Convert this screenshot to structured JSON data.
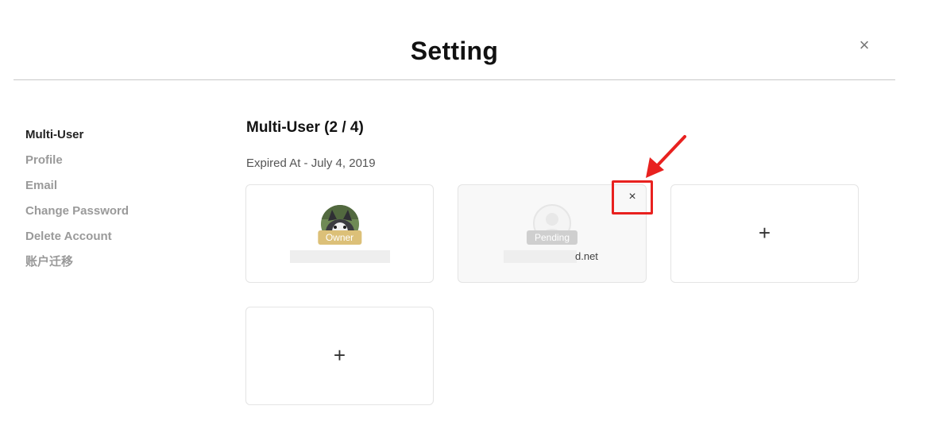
{
  "header": {
    "title": "Setting",
    "close_icon": "×"
  },
  "sidebar": {
    "items": [
      {
        "label": "Multi-User",
        "active": true
      },
      {
        "label": "Profile"
      },
      {
        "label": "Email"
      },
      {
        "label": "Change Password"
      },
      {
        "label": "Delete Account"
      },
      {
        "label": "账户迁移"
      }
    ]
  },
  "main": {
    "title": "Multi-User (2 / 4)",
    "expired": "Expired At - July 4, 2019",
    "cards": [
      {
        "type": "owner",
        "badge": "Owner",
        "email_visible": ""
      },
      {
        "type": "pending",
        "badge": "Pending",
        "email_visible": "d.net",
        "remove_icon": "×"
      },
      {
        "type": "add",
        "icon": "+"
      },
      {
        "type": "add",
        "icon": "+"
      }
    ]
  },
  "colors": {
    "owner_badge": "#dcc078",
    "pending_badge": "#cfcfcf",
    "annotation": "#e8211f"
  }
}
